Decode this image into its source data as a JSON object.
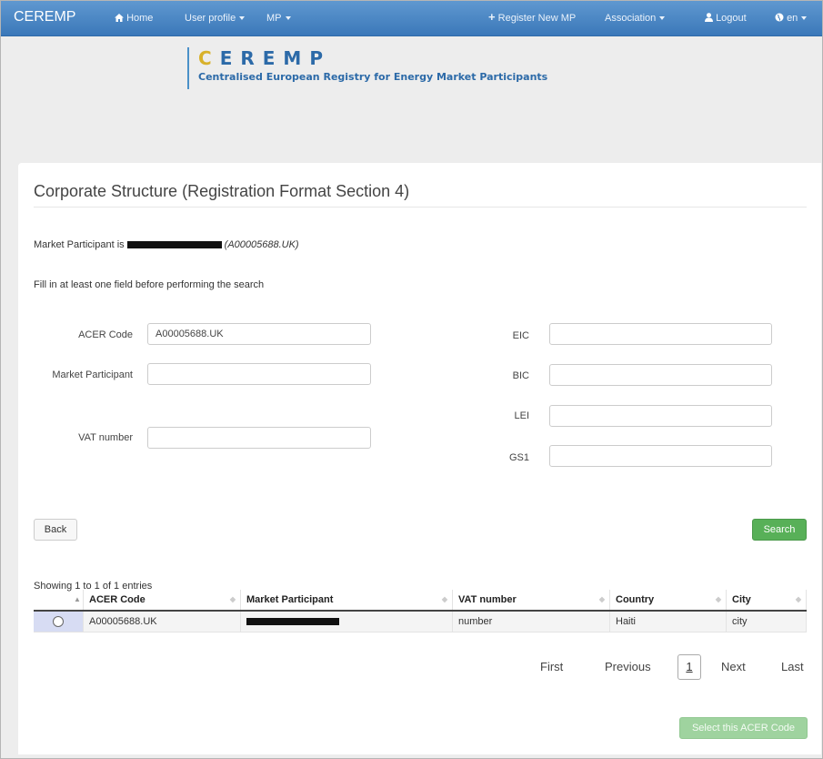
{
  "nav": {
    "brand": "CEREMP",
    "home": "Home",
    "user_profile": "User profile",
    "mp": "MP",
    "register": "Register New MP",
    "association": "Association",
    "logout": "Logout",
    "lang": "en"
  },
  "logo": {
    "title_c": "C",
    "title_rest": "EREMP",
    "subtitle": "Centralised European Registry for Energy Market Participants"
  },
  "panel": {
    "title": "Corporate Structure (Registration Format Section 4)",
    "mp_prefix": "Market Participant is",
    "mp_code": "(A00005688.UK)",
    "hint": "Fill in at least one field before performing the search"
  },
  "form": {
    "acer_label": "ACER Code",
    "acer_value": "A00005688.UK",
    "mp_label": "Market Participant",
    "mp_value": "",
    "vat_label": "VAT number",
    "vat_value": "",
    "eic_label": "EIC",
    "eic_value": "",
    "bic_label": "BIC",
    "bic_value": "",
    "lei_label": "LEI",
    "lei_value": "",
    "gs1_label": "GS1",
    "gs1_value": ""
  },
  "buttons": {
    "back": "Back",
    "search": "Search",
    "select": "Select this ACER Code"
  },
  "table": {
    "info": "Showing 1 to 1 of 1 entries",
    "headers": [
      "ACER Code",
      "Market Participant",
      "VAT number",
      "Country",
      "City"
    ],
    "rows": [
      {
        "acer": "A00005688.UK",
        "vat": "number",
        "country": "Haiti",
        "city": "city"
      }
    ]
  },
  "pagination": {
    "first": "First",
    "previous": "Previous",
    "current": "1",
    "next": "Next",
    "last": "Last"
  },
  "colors": {
    "nav_blue": "#3b78b9",
    "search_green": "#58b058",
    "select_green_disabled": "#9fd39f",
    "selected_row": "#d7dcf3"
  }
}
